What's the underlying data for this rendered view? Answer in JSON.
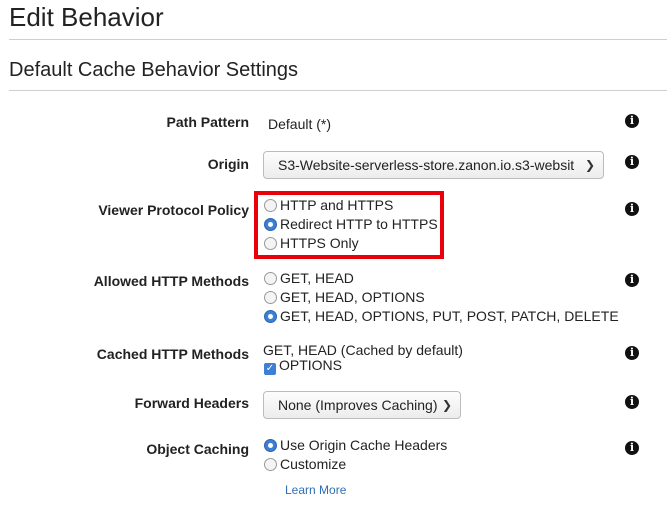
{
  "page": {
    "title": "Edit Behavior",
    "section_title": "Default Cache Behavior Settings"
  },
  "fields": {
    "path_pattern": {
      "label": "Path Pattern",
      "value": "Default (*)"
    },
    "origin": {
      "label": "Origin",
      "selected": "S3-Website-serverless-store.zanon.io.s3-websit"
    },
    "viewer_protocol_policy": {
      "label": "Viewer Protocol Policy",
      "options": [
        "HTTP and HTTPS",
        "Redirect HTTP to HTTPS",
        "HTTPS Only"
      ],
      "selected_index": 1
    },
    "allowed_http_methods": {
      "label": "Allowed HTTP Methods",
      "options": [
        "GET, HEAD",
        "GET, HEAD, OPTIONS",
        "GET, HEAD, OPTIONS, PUT, POST, PATCH, DELETE"
      ],
      "selected_index": 2
    },
    "cached_http_methods": {
      "label": "Cached HTTP Methods",
      "static_text": "GET, HEAD (Cached by default)",
      "checkbox_label": "OPTIONS",
      "checked": true
    },
    "forward_headers": {
      "label": "Forward Headers",
      "selected": "None (Improves Caching)"
    },
    "object_caching": {
      "label": "Object Caching",
      "options": [
        "Use Origin Cache Headers",
        "Customize"
      ],
      "selected_index": 0,
      "link": "Learn More"
    }
  },
  "icons": {
    "info": "info-icon",
    "chevron": "chevron-down-icon",
    "check": "checkmark-icon"
  },
  "colors": {
    "accent": "#3c7fd4",
    "highlight_box": "#e8000b",
    "link": "#2f6fb6"
  }
}
